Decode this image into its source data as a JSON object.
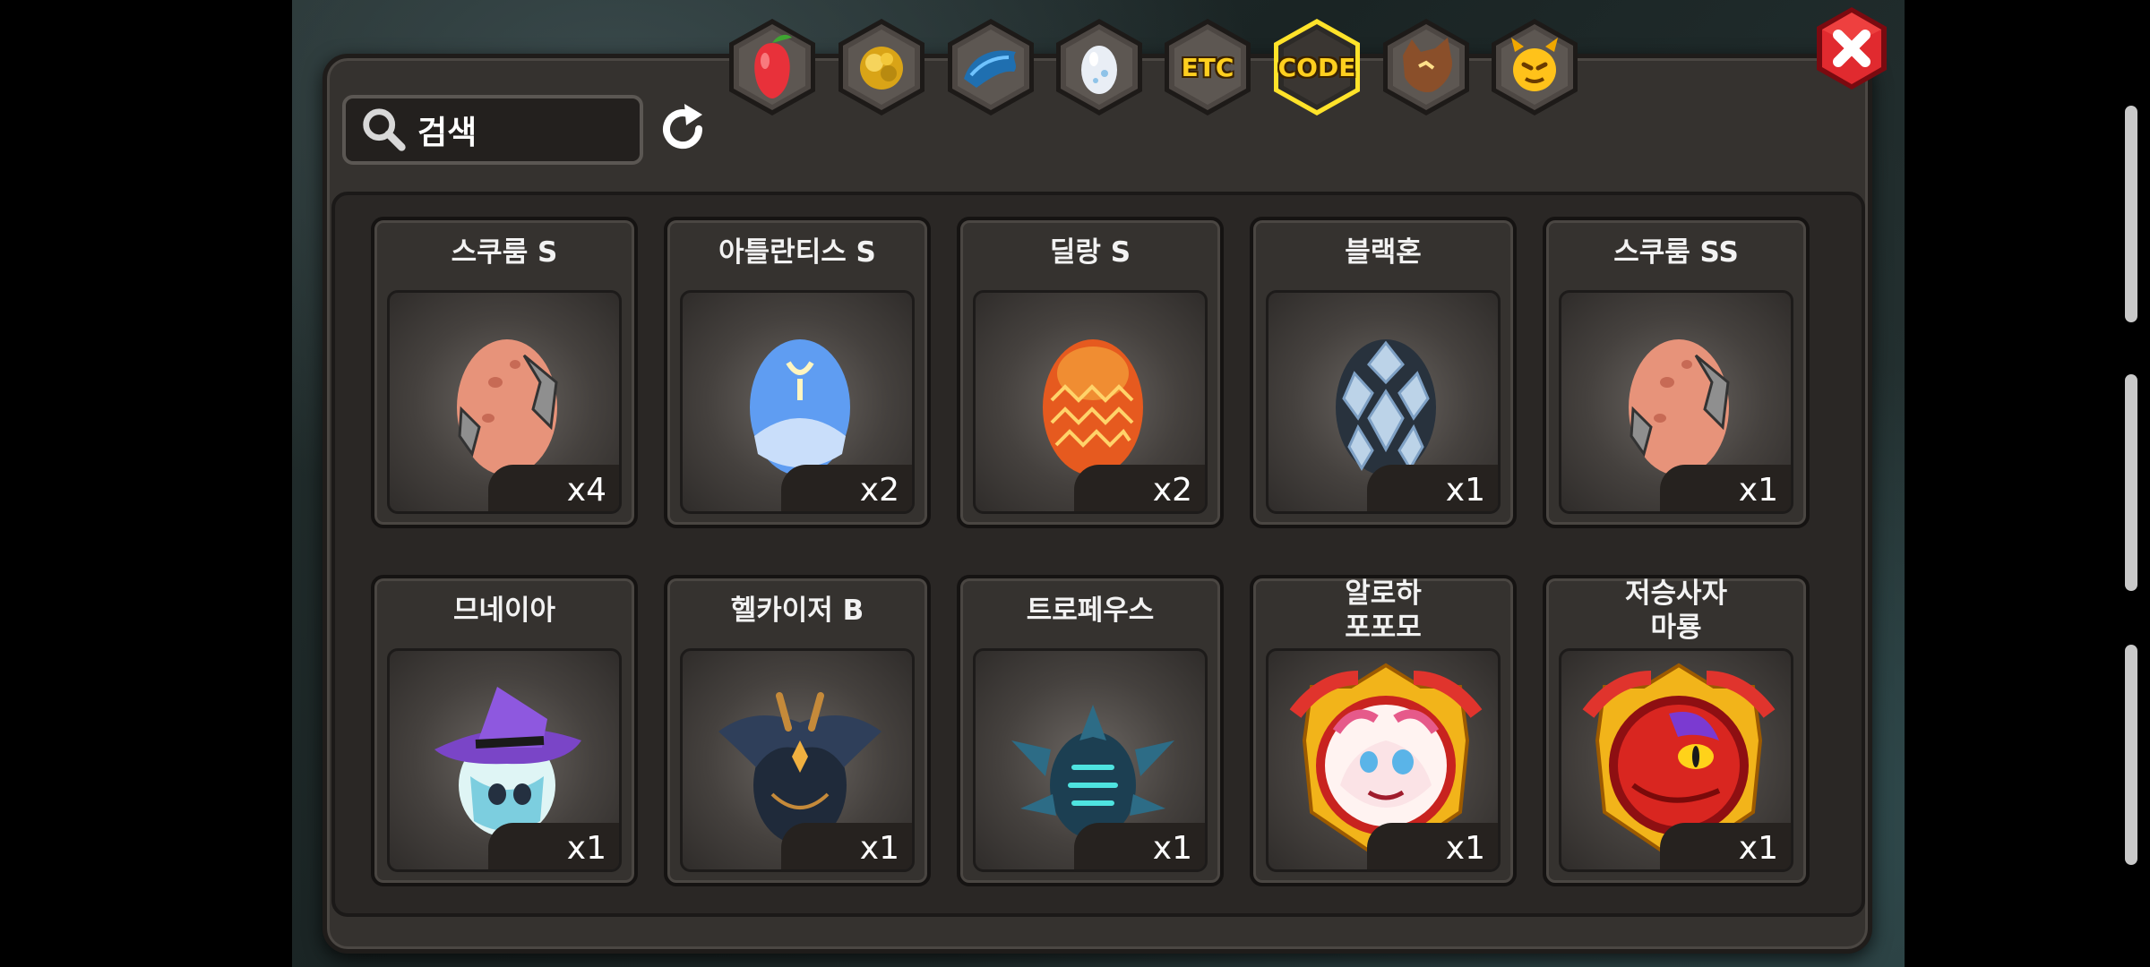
{
  "search": {
    "placeholder": "검색"
  },
  "tabs": [
    {
      "name": "fruit-tab",
      "icon": "red-fruit-icon",
      "label": ""
    },
    {
      "name": "gold-tab",
      "icon": "gold-nugget-icon",
      "label": ""
    },
    {
      "name": "dragon-head-tab",
      "icon": "blue-dragon-head-icon",
      "label": ""
    },
    {
      "name": "egg-tab",
      "icon": "egg-icon",
      "label": ""
    },
    {
      "name": "etc-tab",
      "icon": "",
      "label": "ETC"
    },
    {
      "name": "code-tab",
      "icon": "",
      "label": "CODE",
      "active": true
    },
    {
      "name": "wolf-tab",
      "icon": "wolf-head-icon",
      "label": ""
    },
    {
      "name": "devil-tab",
      "icon": "yellow-devil-face-icon",
      "label": ""
    }
  ],
  "items": [
    {
      "title": "스쿠룸 S",
      "qty": "x4",
      "icon": "pink-armored-egg-icon"
    },
    {
      "title": "아틀란티스 S",
      "qty": "x2",
      "icon": "blue-egg-icon"
    },
    {
      "title": "딜랑 S",
      "qty": "x2",
      "icon": "orange-scaled-egg-icon"
    },
    {
      "title": "블랙혼",
      "qty": "x1",
      "icon": "dark-spiked-egg-icon"
    },
    {
      "title": "스쿠룸 SS",
      "qty": "x1",
      "icon": "pink-armored-egg-icon"
    },
    {
      "title": "므네이아",
      "qty": "x1",
      "icon": "witch-hat-egg-icon"
    },
    {
      "title": "헬카이저 B",
      "qty": "x1",
      "icon": "horned-dark-egg-icon"
    },
    {
      "title": "트로페우스",
      "qty": "x1",
      "icon": "spiked-teal-egg-icon"
    },
    {
      "title": "알로하\n포포모",
      "qty": "x1",
      "icon": "pink-dragon-medallion-icon"
    },
    {
      "title": "저승사자\n마룡",
      "qty": "x1",
      "icon": "red-dragon-medallion-icon"
    }
  ],
  "colors": {
    "accent": "#ffcf1f",
    "panel": "#35322f",
    "close": "#d8202a"
  }
}
